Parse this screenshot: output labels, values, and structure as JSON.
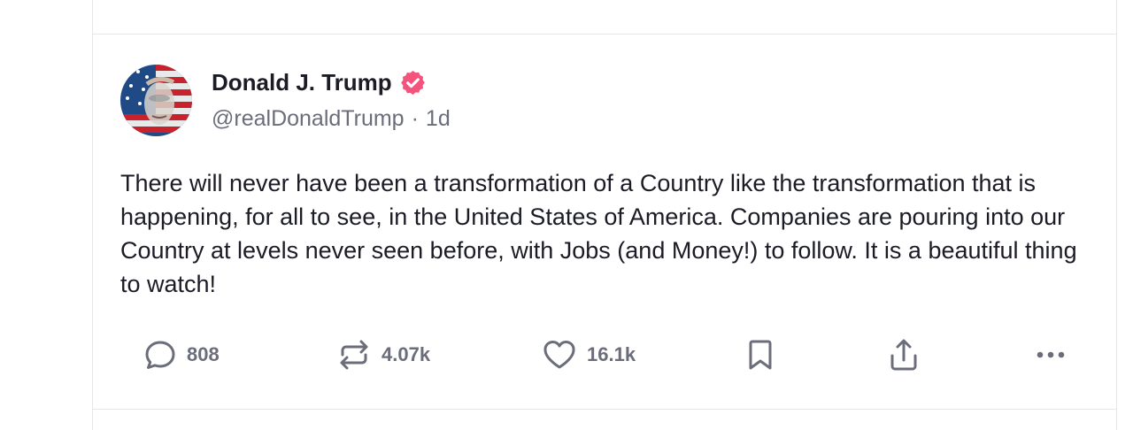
{
  "post": {
    "author": {
      "display_name": "Donald J. Trump",
      "handle": "@realDonaldTrump",
      "separator": "·",
      "time_ago": "1d",
      "verified_badge_color": "#f2547d"
    },
    "body": "There will never have been a transformation of a Country like the transformation that is happening, for all to see, in the United States of America. Companies are pouring into our Country at levels never seen before, with Jobs (and Money!) to follow. It is a beautiful thing to watch!",
    "actions": {
      "reply_count": "808",
      "retruth_count": "4.07k",
      "like_count": "16.1k"
    },
    "icons": {
      "reply": "speech-bubble-icon",
      "retruth": "repost-arrows-icon",
      "like": "heart-icon",
      "bookmark": "bookmark-icon",
      "share": "share-upload-icon",
      "more": "ellipsis-icon"
    }
  },
  "colors": {
    "text_primary": "#1b1c26",
    "text_secondary": "#6b6e7a",
    "divider": "#e6e6ea",
    "accent": "#f2547d"
  }
}
